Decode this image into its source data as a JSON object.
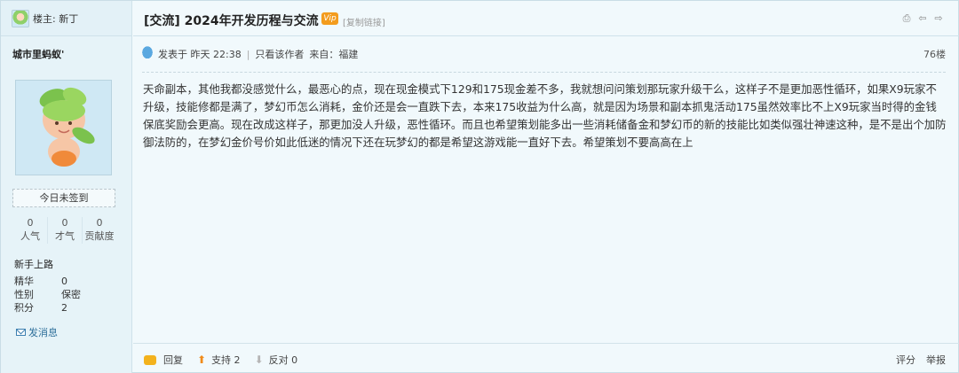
{
  "sidebar": {
    "owner_label": "楼主: 新丁",
    "username": "城市里蚂蚁'",
    "sign_label": "今日未签到",
    "stats": [
      {
        "value": "0",
        "label": "人气"
      },
      {
        "value": "0",
        "label": "才气"
      },
      {
        "value": "0",
        "label": "贡献度"
      }
    ],
    "rank": "新手上路",
    "info": [
      {
        "key": "精华",
        "value": "0"
      },
      {
        "key": "性别",
        "value": "保密"
      },
      {
        "key": "积分",
        "value": "2"
      }
    ],
    "message_label": "发消息"
  },
  "post": {
    "title": "[交流] 2024年开发历程与交流",
    "vip_badge": "Vip",
    "copy_link": "[复制链接]",
    "posted_at": "发表于 昨天 22:38",
    "author_only": "只看该作者",
    "from": "来自：福建",
    "floor": "76楼",
    "content": "天命副本，其他我都没感觉什么，最恶心的点，现在现金模式下129和175现金差不多，我就想问问策划那玩家升级干么，这样子不是更加恶性循环，如果X9玩家不升级，技能修都是满了，梦幻币怎么消耗，金价还是会一直跌下去，本来175收益为什么高，就是因为场景和副本抓鬼活动175虽然效率比不上X9玩家当时得的金钱保底奖励会更高。现在改成这样子，那更加没人升级，恶性循环。而且也希望策划能多出一些消耗储备金和梦幻币的新的技能比如类似强壮神速这种，是不是出个加防御法防的，在梦幻金价号价如此低迷的情况下还在玩梦幻的都是希望这游戏能一直好下去。希望策划不要高高在上"
  },
  "footer": {
    "reply": "回复",
    "support": "支持 2",
    "oppose": "反对 0",
    "rate": "评分",
    "report": "举报"
  },
  "icons": [
    "print-icon",
    "prev-arrow-icon",
    "next-arrow-icon",
    "reply-icon",
    "thumb-up-icon",
    "thumb-down-icon",
    "envelope-icon"
  ]
}
